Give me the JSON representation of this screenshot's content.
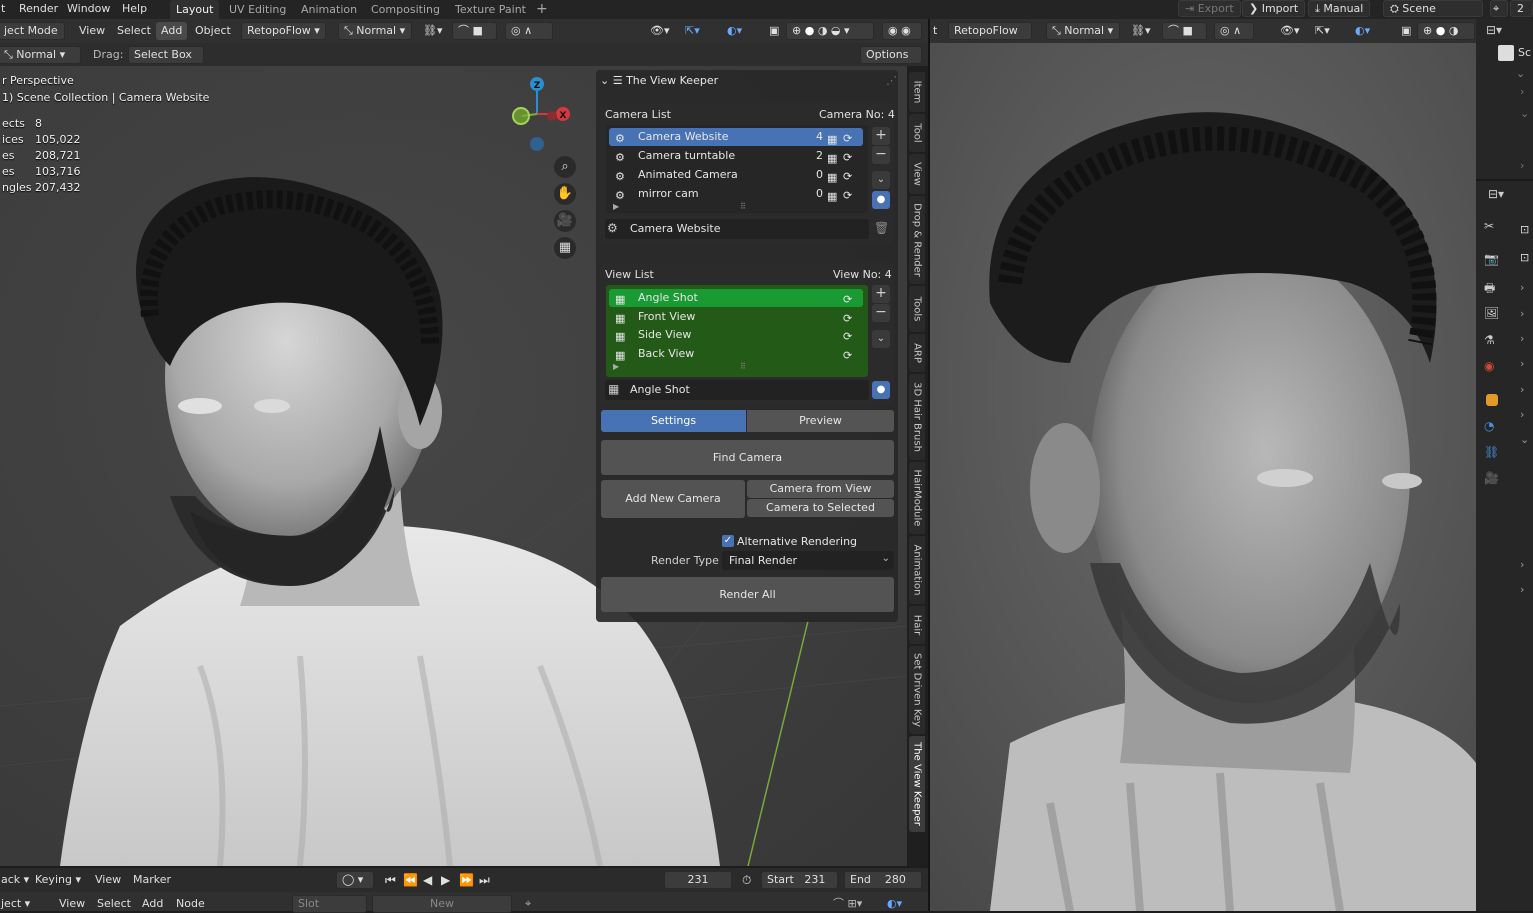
{
  "menu": {
    "items": [
      "t",
      "Render",
      "Window",
      "Help"
    ]
  },
  "workspaces": [
    "Layout",
    "UV Editing",
    "Animation",
    "Compositing",
    "Texture Paint",
    "+"
  ],
  "topright": {
    "export": "Export",
    "import": "Import",
    "manual": "Manual",
    "scene": "Scene",
    "num": "2"
  },
  "header3d": {
    "mode": "ject Mode",
    "view": "View",
    "select": "Select",
    "add": "Add",
    "object": "Object",
    "retopo": "RetopoFlow",
    "orientation": "Normal"
  },
  "tooloptions": {
    "orient": "Normal",
    "drag_label": "Drag:",
    "drag_value": "Select Box",
    "options": "Options"
  },
  "overlay": {
    "perspective": "r Perspective",
    "collection": "1) Scene Collection | Camera Website"
  },
  "stats": [
    {
      "label": "ects",
      "value": "8"
    },
    {
      "label": "ices",
      "value": "105,022"
    },
    {
      "label": "es",
      "value": "208,721"
    },
    {
      "label": "es",
      "value": "103,716"
    },
    {
      "label": "ngles",
      "value": "207,432"
    }
  ],
  "gizmo": {
    "z": "Z",
    "x": "X"
  },
  "panel": {
    "title": "The View Keeper",
    "camera_list_label": "Camera List",
    "camera_no_label": "Camera No:",
    "camera_no": "4",
    "cameras": [
      {
        "name": "Camera Website",
        "count": "4"
      },
      {
        "name": "Camera turntable",
        "count": "2"
      },
      {
        "name": "Animated Camera",
        "count": "0"
      },
      {
        "name": "mirror cam",
        "count": "0"
      }
    ],
    "camera_field": "Camera Website",
    "view_list_label": "View List",
    "view_no_label": "View No:",
    "view_no": "4",
    "views": [
      {
        "name": "Angle Shot"
      },
      {
        "name": "Front View"
      },
      {
        "name": "Side View"
      },
      {
        "name": "Back View"
      }
    ],
    "view_field": "Angle Shot",
    "tab_settings": "Settings",
    "tab_preview": "Preview",
    "find_camera": "Find Camera",
    "add_new_camera": "Add New Camera",
    "camera_from_view": "Camera from View",
    "camera_to_selected": "Camera to Selected",
    "alt_rendering": "Alternative Rendering",
    "render_type_label": "Render Type",
    "render_type": "Final Render",
    "render_all": "Render All"
  },
  "sidetabs": [
    "Item",
    "Tool",
    "View",
    "Drop & Render",
    "Tools",
    "ARP",
    "3D Hair Brush",
    "HairModule",
    "Animation",
    "Hair",
    "Set Driven Key",
    "The View Keeper"
  ],
  "rightheader": {
    "retopo": "RetopoFlow",
    "orient": "Normal"
  },
  "timeline": {
    "ack": "ack",
    "keying": "Keying",
    "view": "View",
    "marker": "Marker",
    "frame": "231",
    "start_label": "Start",
    "start": "231",
    "end_label": "End",
    "end": "280"
  },
  "bottombar": {
    "ject": "ject",
    "view": "View",
    "select": "Select",
    "add": "Add",
    "node": "Node",
    "slot": "Slot",
    "new": "New"
  },
  "props": {
    "sc": "Sc"
  },
  "colors": {
    "selected": "#4772b3",
    "green": "#1a8a2e",
    "green_bg": "#235a18"
  }
}
